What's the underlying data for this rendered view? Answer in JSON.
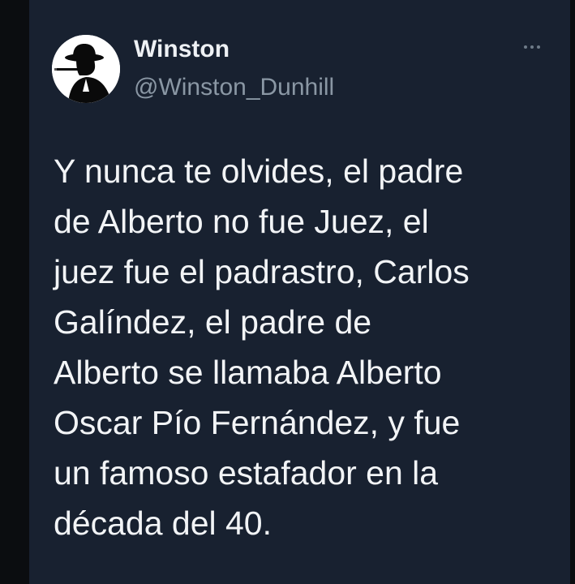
{
  "tweet": {
    "author": {
      "display_name": "Winston",
      "handle": "@Winston_Dunhill",
      "avatar_icon": "silhouette-hat-cigar-icon"
    },
    "more_icon": "more-options-icon",
    "text_lines": [
      "Y nunca te olvides, el padre",
      "de Alberto no fue Juez, el",
      "juez fue el padrastro, Carlos",
      "Galíndez, el padre de",
      "Alberto se llamaba Alberto",
      "Oscar Pío Fernández, y fue",
      "un famoso estafador en la",
      "década del 40."
    ]
  },
  "colors": {
    "background": "#0b0d10",
    "card": "#182130",
    "text_primary": "#f2f4f6",
    "text_secondary": "#8a97a4"
  }
}
